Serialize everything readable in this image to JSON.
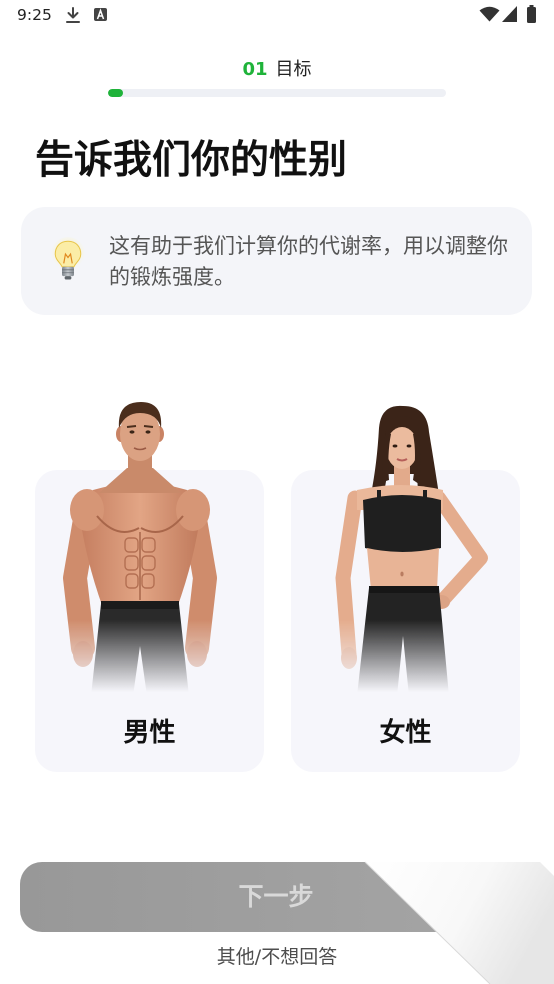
{
  "status_bar": {
    "time": "9:25",
    "left_icons": [
      "download-icon",
      "a-notification-icon"
    ],
    "right_icons": [
      "wifi-icon",
      "signal-icon",
      "battery-icon"
    ]
  },
  "progress": {
    "step": "01",
    "label": "目标",
    "fraction": 0.045
  },
  "heading": "告诉我们你的性别",
  "info_card": {
    "icon": "lightbulb-icon",
    "text": "这有助于我们计算你的代谢率，用以调整你的锻炼强度。"
  },
  "options": [
    {
      "label": "男性",
      "illustration": "male-figure-illustration"
    },
    {
      "label": "女性",
      "illustration": "female-figure-illustration"
    }
  ],
  "next_button": {
    "label": "下一步",
    "enabled": false
  },
  "skip_link": {
    "label": "其他/不想回答"
  },
  "colors": {
    "accent": "#1fb33a",
    "heading_text": "#111111",
    "body_text": "#555555",
    "card_background": "#f6f6fb",
    "info_background": "#f4f5f9",
    "button_disabled": "#a3a3a3",
    "button_label_disabled": "#d9d9d9"
  }
}
